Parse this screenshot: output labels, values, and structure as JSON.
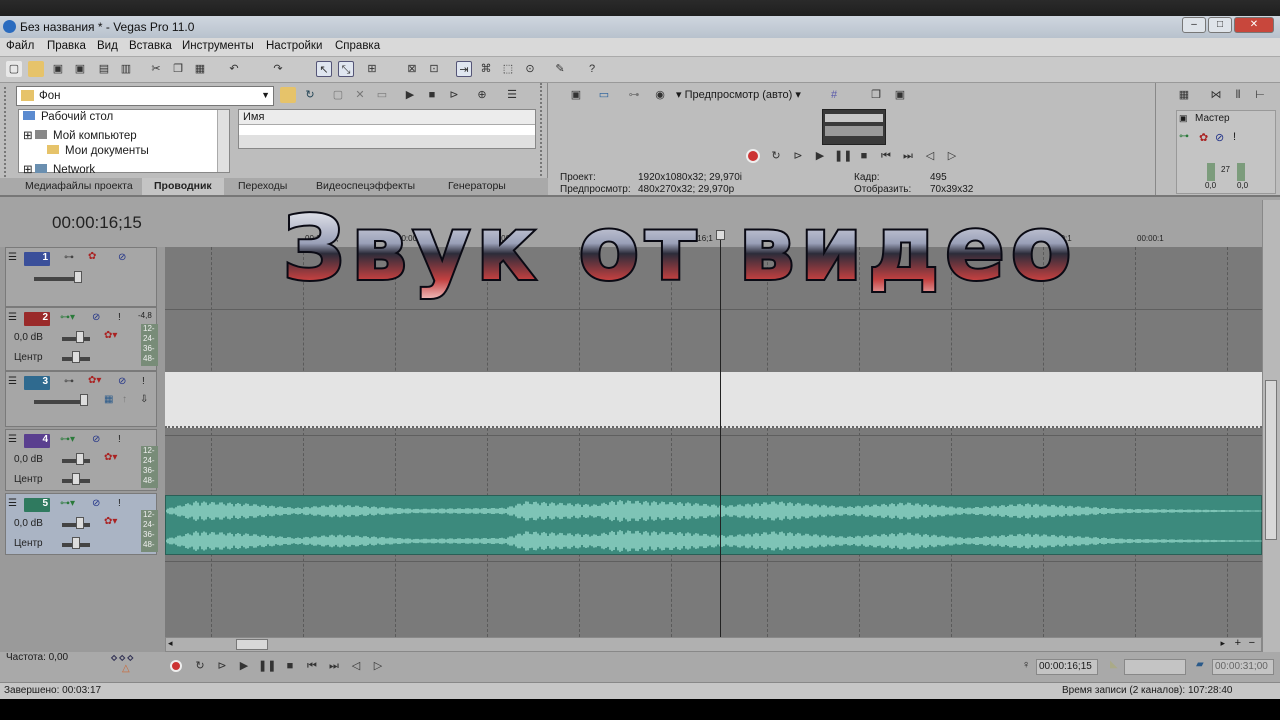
{
  "window": {
    "title": "Без названия * - Vegas Pro 11.0",
    "minimize": "–",
    "maximize": "□",
    "close": "✕"
  },
  "menu": [
    "Файл",
    "Правка",
    "Вид",
    "Вставка",
    "Инструменты",
    "Настройки",
    "Справка"
  ],
  "explorer": {
    "path": "Фон",
    "tree": [
      "Рабочий стол",
      "Мой компьютер",
      "Мои документы",
      "Network"
    ],
    "list_header": "Имя",
    "tabs": [
      "Медиафайлы проекта",
      "Проводник",
      "Переходы",
      "Видеоспецэффекты",
      "Генераторы"
    ]
  },
  "preview": {
    "mode": "Предпросмотр (авто)",
    "project_label": "Проект:",
    "project_value": "1920x1080x32; 29,970i",
    "preview_label": "Предпросмотр:",
    "preview_value": "480x270x32; 29,970p",
    "frame_label": "Кадр:",
    "frame_value": "495",
    "display_label": "Отобразить:",
    "display_value": "70x39x32"
  },
  "master": {
    "label": "Мастер",
    "db_left": "0,0",
    "db_right": "0,0",
    "meter_value": "27"
  },
  "timeline": {
    "timecode": "00:00:16;15",
    "ruler": [
      "00:00:15;",
      "00:00:1",
      "00:00:15;",
      "00:00:16;1",
      "17;00",
      "00:00:1",
      "00:00:1",
      "00:00:1"
    ],
    "tracks": [
      {
        "num": "1",
        "color": "#3a4f9a"
      },
      {
        "num": "2",
        "color": "#9a2a2a",
        "db": "0,0 dB",
        "pan": "Центр",
        "meter": "-4,8"
      },
      {
        "num": "3",
        "color": "#2f6a8f"
      },
      {
        "num": "4",
        "color": "#5a3f8f",
        "db": "0,0 dB",
        "pan": "Центр"
      },
      {
        "num": "5",
        "color": "#2f7a5f",
        "db": "0,0 dB",
        "pan": "Центр"
      }
    ],
    "meter_ticks": [
      "12-",
      "24-",
      "36-",
      "48-"
    ]
  },
  "overlay_text": "Звук от видео",
  "transport": {
    "rate": "Частота: 0,00",
    "cursor_time": "00:00:16;15",
    "end_time": "00:00:31;00"
  },
  "status": {
    "done": "Завершено: 00:03:17",
    "record_time": "Время записи (2 каналов): 107:28:40"
  },
  "colors": {
    "audio_clip": "#3c8a7d",
    "wave": "#8fd3c5"
  }
}
